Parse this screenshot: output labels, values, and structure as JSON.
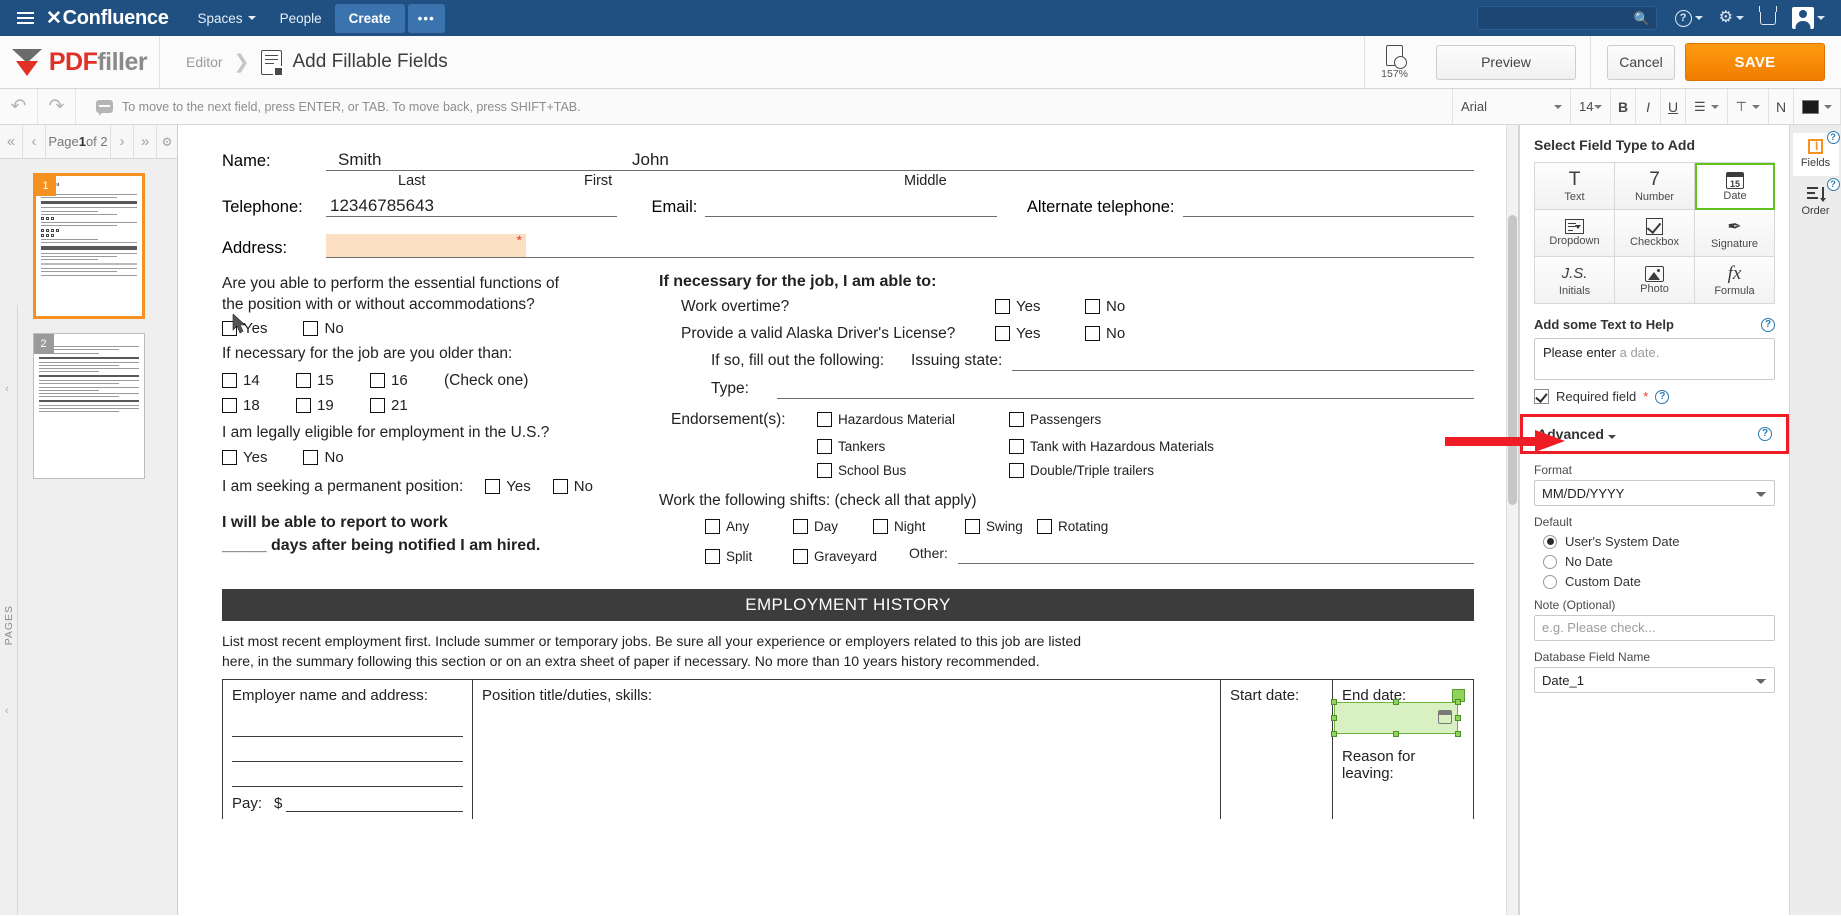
{
  "confluence": {
    "brand": "Confluence",
    "nav": [
      {
        "label": "Spaces",
        "caret": true
      },
      {
        "label": "People",
        "caret": false
      }
    ],
    "create_label": "Create",
    "more_label": "•••",
    "search_placeholder": "",
    "icons": [
      "help-icon",
      "settings-gear-icon",
      "notifications-tray-icon",
      "user-avatar-icon"
    ]
  },
  "pdffiller": {
    "brand_a": "PDF",
    "brand_b": "filler",
    "breadcrumb_editor": "Editor",
    "page_title": "Add Fillable Fields",
    "zoom_level": "157%",
    "preview_label": "Preview",
    "cancel_label": "Cancel",
    "save_label": "SAVE"
  },
  "toolbar": {
    "hint": "To move to the next field, press ENTER, or TAB. To move back, press SHIFT+TAB.",
    "font_family": "Arial",
    "font_size": "14",
    "bold": "B",
    "italic": "I",
    "underline": "U",
    "numbering": "N"
  },
  "pages_panel": {
    "nav_first": "«",
    "nav_prev": "‹",
    "nav_next": "›",
    "nav_last": "»",
    "page_text_prefix": "Page ",
    "page_current": "1",
    "page_text_suffix": " of 2",
    "vertical_label": "PAGES",
    "thumbnails": [
      {
        "number": "1",
        "title_line1": "ployment",
        "title_line2": "lication",
        "selected": true
      },
      {
        "number": "2",
        "title_line1": "",
        "title_line2": "",
        "selected": false
      }
    ]
  },
  "document": {
    "name_label": "Name:",
    "name_last_value": "Smith",
    "name_first_value": "John",
    "sub_last": "Last",
    "sub_first": "First",
    "sub_middle": "Middle",
    "telephone_label": "Telephone:",
    "telephone_value": "12346785643",
    "email_label": "Email:",
    "alt_phone_label": "Alternate telephone:",
    "address_label": "Address:",
    "address_required_mark": "*",
    "q_essential_line1": "Are you able to perform the essential functions of",
    "q_essential_line2": "the position with or without accommodations?",
    "yes": "Yes",
    "no": "No",
    "q_older_than": "If necessary for the job are you older than:",
    "ages_row1": [
      "14",
      "15",
      "16"
    ],
    "check_one": "(Check one)",
    "ages_row2": [
      "18",
      "19",
      "21"
    ],
    "q_eligible": "I am legally eligible for employment in the U.S.?",
    "q_permanent": "I am seeking a permanent position:",
    "report_line1": "I will be able to report to work",
    "report_line2": "_____ days after being notified I am hired.",
    "r_heading": "If necessary for the job, I am able to:",
    "r_overtime": "Work overtime?",
    "r_license": "Provide a valid Alaska Driver's License?",
    "r_ifso": "If so, fill out the following:",
    "r_issuing": "Issuing state:",
    "r_type": "Type:",
    "r_endorsements": "Endorsement(s):",
    "endorsements": [
      [
        "Hazardous Material",
        "Passengers"
      ],
      [
        "Tankers",
        "Tank with Hazardous Materials"
      ],
      [
        "School Bus",
        "Double/Triple trailers"
      ]
    ],
    "shifts_heading": "Work the following shifts: (check all that apply)",
    "shifts_row1": [
      "Any",
      "Day",
      "Night",
      "Swing",
      "Rotating"
    ],
    "shifts_row2": [
      "Split",
      "Graveyard"
    ],
    "other_label": "Other:",
    "eh_banner": "EMPLOYMENT HISTORY",
    "eh_note_line1": "List most recent employment first. Include summer or temporary jobs. Be sure all your experience or employers related to this job are listed",
    "eh_note_line2": "here, in the summary following this section or on an extra sheet of paper if necessary. No more than 10 years history recommended.",
    "eh_col_employer": "Employer name and address:",
    "eh_col_position": "Position title/duties, skills:",
    "eh_col_start": "Start date:",
    "eh_col_end": "End date:",
    "eh_reason": "Reason for leaving:",
    "eh_pay": "Pay:",
    "eh_pay_sym": "$"
  },
  "right_panel": {
    "select_title": "Select Field Type to Add",
    "field_types": [
      {
        "label": "Text",
        "icon": "text-T-icon",
        "glyph": "T",
        "active": false
      },
      {
        "label": "Number",
        "icon": "number-7-icon",
        "glyph": "7",
        "active": false
      },
      {
        "label": "Date",
        "icon": "calendar-icon",
        "glyph": "15",
        "active": true
      },
      {
        "label": "Dropdown",
        "icon": "dropdown-list-icon",
        "glyph": "",
        "active": false
      },
      {
        "label": "Checkbox",
        "icon": "checkbox-check-icon",
        "glyph": "",
        "active": false
      },
      {
        "label": "Signature",
        "icon": "signature-pen-icon",
        "glyph": "✒",
        "active": false
      },
      {
        "label": "Initials",
        "icon": "initials-js-icon",
        "glyph": "J.S.",
        "active": false
      },
      {
        "label": "Photo",
        "icon": "photo-image-icon",
        "glyph": "",
        "active": false
      },
      {
        "label": "Formula",
        "icon": "formula-fx-icon",
        "glyph": "fx",
        "active": false
      }
    ],
    "help_title": "Add some Text to Help",
    "help_value": "Please enter",
    "help_placeholder_tail": " a date.",
    "required_label": "Required field",
    "required_star": "*",
    "required_checked": true,
    "advanced_label": "Advanced",
    "advanced_highlight_color": "#ee1c25",
    "format_label": "Format",
    "format_value": "MM/DD/YYYY",
    "default_label": "Default",
    "default_options": [
      {
        "label": "User's System Date",
        "selected": true
      },
      {
        "label": "No Date",
        "selected": false
      },
      {
        "label": "Custom Date",
        "selected": false
      }
    ],
    "note_label": "Note (Optional)",
    "note_placeholder": "e.g. Please check...",
    "db_label": "Database Field Name",
    "db_value": "Date_1",
    "help_icon": "question-circle-icon"
  },
  "rail": {
    "items": [
      {
        "label": "Fields",
        "icon": "fields-bracket-icon",
        "active": true
      },
      {
        "label": "Order",
        "icon": "order-list-icon",
        "active": false
      }
    ]
  }
}
